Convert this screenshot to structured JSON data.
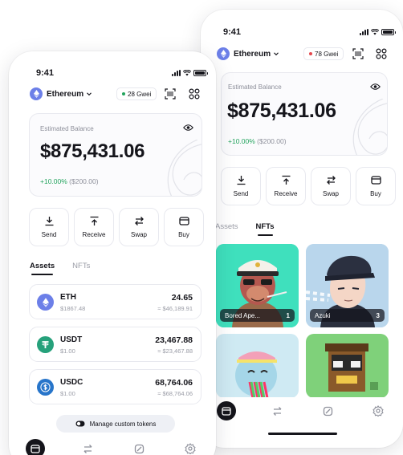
{
  "back_phone": {
    "time": "9:41",
    "network": "Ethereum",
    "gas": "78 Gwei",
    "balance_label": "Estimated Balance",
    "balance": "$875,431.06",
    "change_pct": "+10.00%",
    "change_abs": "($200.00)",
    "actions": [
      "Send",
      "Receive",
      "Swap",
      "Buy"
    ],
    "tabs": [
      "Assets",
      "NFTs"
    ],
    "nfts": [
      {
        "name": "Bored Ape...",
        "count": "1"
      },
      {
        "name": "Azuki",
        "count": "3"
      }
    ]
  },
  "front_phone": {
    "time": "9:41",
    "network": "Ethereum",
    "gas": "28 Gwei",
    "balance_label": "Estimated Balance",
    "balance": "$875,431.06",
    "change_pct": "+10.00%",
    "change_abs": "($200.00)",
    "actions": [
      "Send",
      "Receive",
      "Swap",
      "Buy"
    ],
    "tabs": [
      "Assets",
      "NFTs"
    ],
    "tokens": [
      {
        "symbol": "ETH",
        "price": "$1867.48",
        "amount": "24.65",
        "usd": "≈ $46,189.91"
      },
      {
        "symbol": "USDT",
        "price": "$1.00",
        "amount": "23,467.88",
        "usd": "≈ $23,467.88"
      },
      {
        "symbol": "USDC",
        "price": "$1.00",
        "amount": "68,764.06",
        "usd": "≈ $68,764.06"
      }
    ],
    "manage_label": "Manage custom tokens"
  },
  "colors": {
    "accent_dark": "#15151b",
    "positive": "#21a35c",
    "gas_green": "#21a35c",
    "gas_red": "#e5484d",
    "eth": "#6c7fe8",
    "usdt": "#26a17b",
    "usdc": "#2775ca"
  },
  "icons": {
    "network": "ethereum-icon",
    "scan": "scan-icon",
    "grid": "grid-icon",
    "eye": "eye-icon",
    "send": "send-icon",
    "receive": "receive-icon",
    "swap": "swap-icon",
    "buy": "card-icon",
    "nav": [
      "wallet-icon",
      "swap-icon",
      "browser-icon",
      "settings-icon"
    ]
  }
}
